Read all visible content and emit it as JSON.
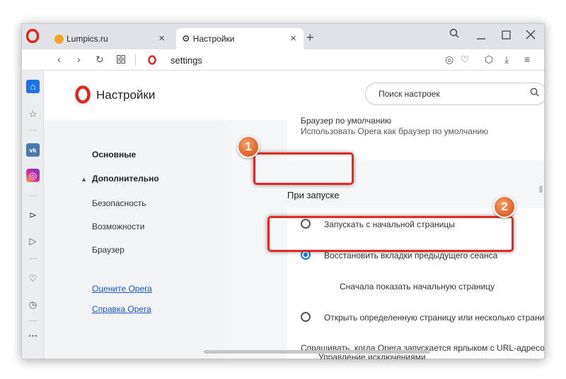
{
  "tabs": [
    {
      "label": "Lumpics.ru",
      "close": "×",
      "favicon": "orange-circle"
    },
    {
      "label": "Настройки",
      "close": "×",
      "favicon": "gear-icon"
    }
  ],
  "new_tab": "+",
  "window_controls": {
    "search": "⌕",
    "minimize": "—",
    "maximize": "☐",
    "close": "✕"
  },
  "address": {
    "url": "settings"
  },
  "sidebar_icons": [
    "home-icon",
    "bookmark-star-icon",
    "vk-icon",
    "instagram-icon",
    "play-icon",
    "send-icon",
    "heart-icon",
    "history-icon",
    "more-icon"
  ],
  "settings": {
    "title": "Настройки",
    "search_placeholder": "Поиск настроек",
    "nav": {
      "basic": "Основные",
      "advanced": "Дополнительно",
      "security": "Безопасность",
      "features": "Возможности",
      "browser": "Браузер",
      "rate": "Оцените Opera",
      "help": "Справка Opera"
    },
    "default_browser": {
      "title": "Браузер по умолчанию",
      "description": "Использовать Opera как браузер по умолчанию"
    },
    "startup": {
      "heading": "При запуске",
      "options": [
        {
          "label": "Запускать с начальной страницы",
          "selected": false
        },
        {
          "label": "Восстановить вкладки предыдущего сеанса",
          "selected": true
        },
        {
          "label": "Открыть определенную страницу или несколько страниц",
          "selected": false
        }
      ],
      "sub_option": "Сначала показать начальную страницу",
      "ask_url": "Спрашивать, когда Opera запускается ярлыком с URL-адресом",
      "manage_exceptions": "Управление исключениями"
    }
  },
  "annotations": {
    "badge1": "1",
    "badge2": "2"
  },
  "colors": {
    "accent": "#1a73e8",
    "opera_red": "#e1261c",
    "highlight": "#e32828"
  }
}
